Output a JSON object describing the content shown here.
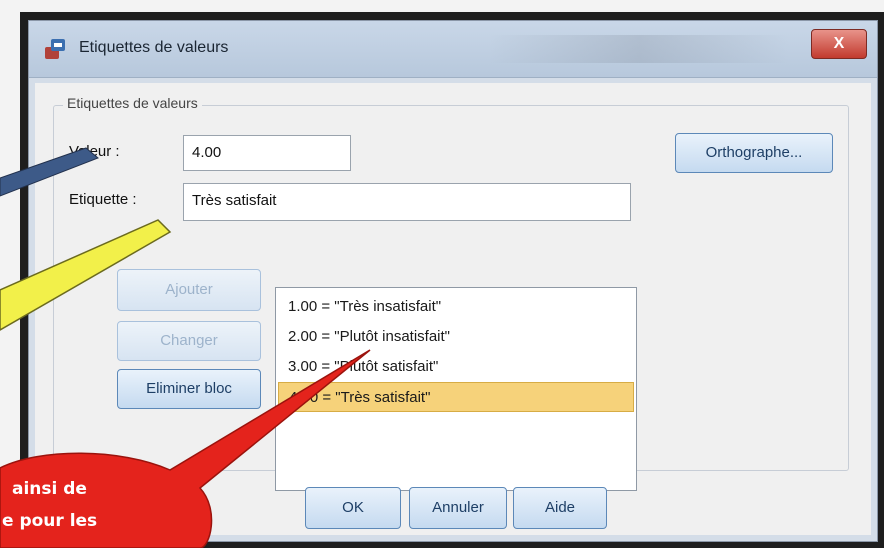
{
  "window": {
    "title": "Etiquettes de valeurs",
    "close_label": "X"
  },
  "group": {
    "legend": "Etiquettes de valeurs"
  },
  "fields": {
    "value_label": "Valeur :",
    "value": "4.00",
    "label_label": "Etiquette :",
    "label_value": "Très satisfait"
  },
  "buttons": {
    "spelling": "Orthographe...",
    "add": "Ajouter",
    "change": "Changer",
    "remove": "Eliminer bloc",
    "ok": "OK",
    "cancel": "Annuler",
    "help": "Aide"
  },
  "list_items": [
    "1.00 = \"Très insatisfait\"",
    "2.00 = \"Plutôt insatisfait\"",
    "3.00 = \"Plutôt satisfait\"",
    "4.00 = \"Très satisfait\""
  ],
  "selected_index": 3,
  "callout": {
    "line1": "ainsi de",
    "line2": "e pour les"
  }
}
